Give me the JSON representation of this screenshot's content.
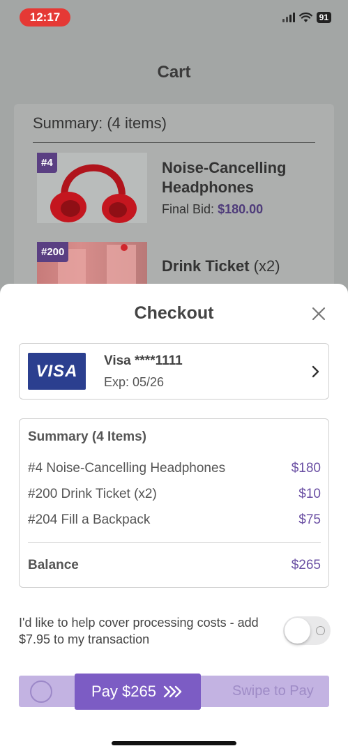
{
  "status": {
    "time": "12:17",
    "battery": "91"
  },
  "page": {
    "title": "Cart"
  },
  "cart_summary": {
    "heading": "Summary: (4 items)",
    "items": [
      {
        "tag": "#4",
        "name": "Noise-Cancelling Headphones",
        "bid_label": "Final Bid:",
        "bid_value": "$180.00"
      },
      {
        "tag": "#200",
        "name": "Drink Ticket",
        "qty": "(x2)"
      }
    ]
  },
  "checkout": {
    "title": "Checkout",
    "card": {
      "brand": "VISA",
      "name": "Visa ****1111",
      "exp": "Exp: 05/26"
    },
    "summary": {
      "title": "Summary (4 Items)",
      "lines": [
        {
          "label": "#4 Noise-Cancelling Headphones",
          "price": "$180"
        },
        {
          "label": "#200 Drink Ticket (x2)",
          "price": "$10"
        },
        {
          "label": "#204 Fill a Backpack",
          "price": "$75"
        }
      ],
      "balance_label": "Balance",
      "balance_value": "$265"
    },
    "cover_text": "I'd like to help cover processing costs - add $7.95 to my transaction",
    "cover_toggle_on": false,
    "pay_label": "Pay $265",
    "swipe_hint": "Swipe to Pay"
  },
  "colors": {
    "accent": "#7c5cc4",
    "price": "#6a4fa3",
    "visa": "#2b3f8f",
    "status_pill": "#e53935"
  }
}
